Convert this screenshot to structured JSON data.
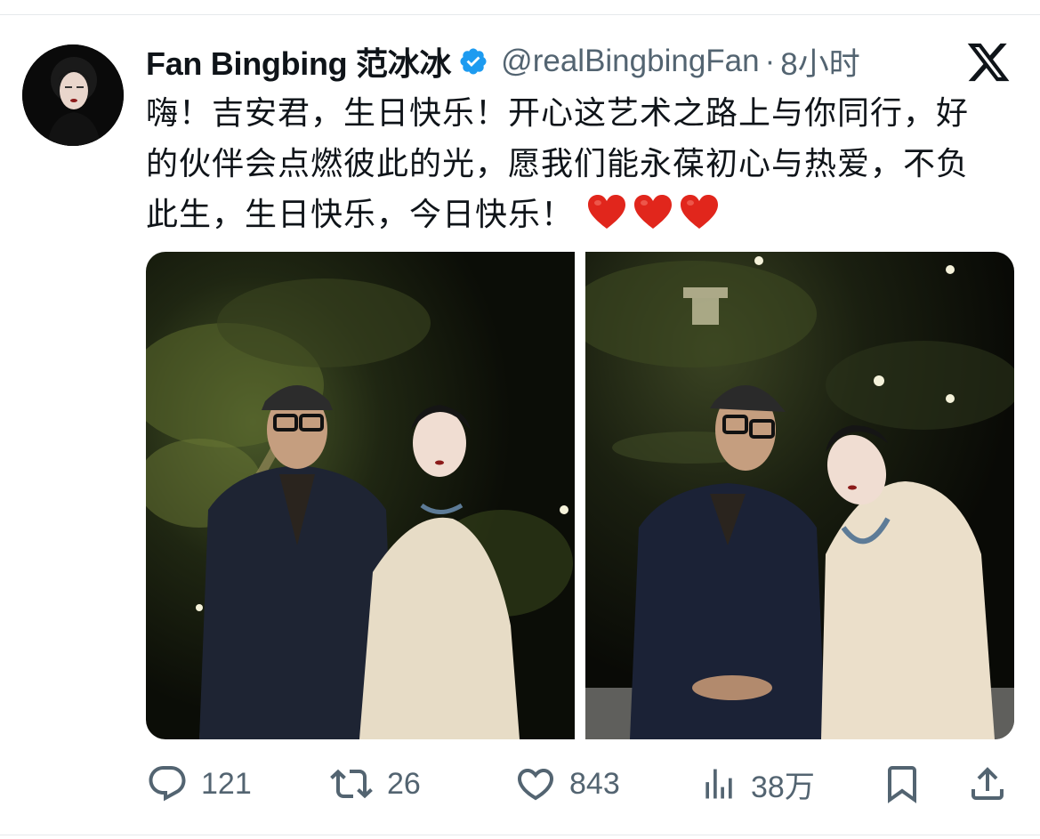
{
  "author": {
    "display_name": "Fan Bingbing 范冰冰",
    "handle": "@realBingbingFan",
    "separator": "·",
    "time": "8小时",
    "verified": true,
    "avatar_icon": "profile-photo"
  },
  "platform_icon": "x-logo-icon",
  "tweet": {
    "lines": [
      "嗨！吉安君，生日快乐！开心这艺术之路上与你同行，好",
      "的伙伴会点燃彼此的光，愿我们能永葆初心与热爱，不负",
      "此生，生日快乐，今日快乐！"
    ],
    "emoji": [
      "heart-emoji",
      "heart-emoji",
      "heart-emoji"
    ]
  },
  "media": {
    "photos": [
      {
        "name": "photo-1"
      },
      {
        "name": "photo-2"
      }
    ]
  },
  "actions": {
    "reply": {
      "icon": "reply-icon",
      "count": "121"
    },
    "retweet": {
      "icon": "retweet-icon",
      "count": "26"
    },
    "like": {
      "icon": "heart-icon",
      "count": "843"
    },
    "views": {
      "icon": "views-icon",
      "count": "38万"
    },
    "bookmark": {
      "icon": "bookmark-icon"
    },
    "share": {
      "icon": "share-icon"
    }
  },
  "colors": {
    "text": "#0f1419",
    "secondary": "#536471",
    "verified": "#1d9bf0",
    "heart": "#e0245e",
    "divider": "#e6e9ec"
  }
}
